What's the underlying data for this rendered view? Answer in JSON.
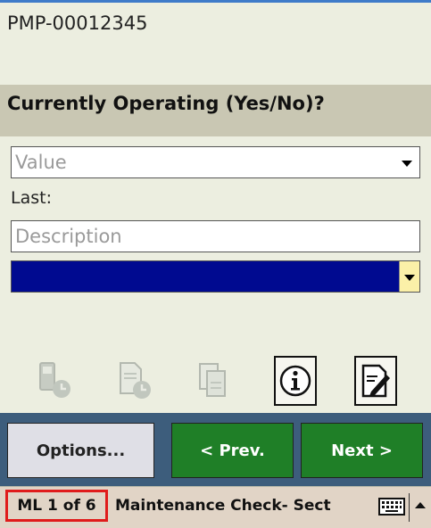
{
  "header": {
    "asset_id": "PMP-00012345"
  },
  "question": {
    "text": "Currently Operating (Yes/No)?"
  },
  "value_field": {
    "placeholder": "Value"
  },
  "last": {
    "label": "Last:"
  },
  "description_field": {
    "placeholder": "Description"
  },
  "toolbar": {
    "icons": [
      "device-clock-icon",
      "document-clock-icon",
      "copy-document-icon",
      "info-icon",
      "edit-note-icon"
    ]
  },
  "nav": {
    "options_label": "Options...",
    "prev_label": "< Prev.",
    "next_label": "Next >"
  },
  "status": {
    "count": "ML 1 of 6",
    "section": "Maintenance Check- Sect"
  },
  "colors": {
    "green_button": "#1f7f27",
    "nav_bar": "#3d5d7c",
    "selection_fill": "#000a90",
    "highlight_border": "#e01b1b"
  }
}
